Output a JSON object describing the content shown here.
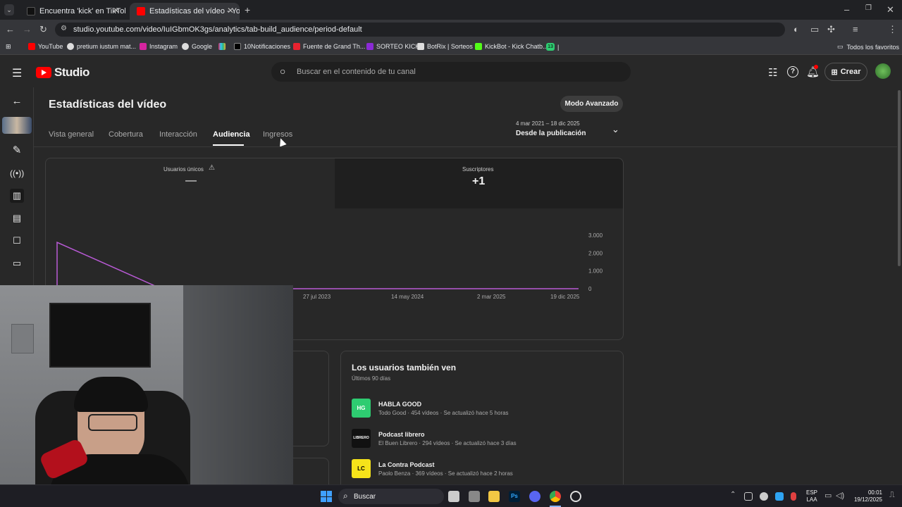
{
  "browser": {
    "tabs": [
      {
        "title": "Encuentra 'kick' en TikTok | Bus",
        "active": false
      },
      {
        "title": "Estadísticas del vídeo - YouTube",
        "active": true
      }
    ],
    "url": "studio.youtube.com/video/IuIGbmOK3gs/analytics/tab-build_audience/period-default",
    "bookmarks": [
      "YouTube",
      "pretium iustum mat...",
      "Instagram",
      "Google",
      "10Notificaciones",
      "Fuente de Grand Th...",
      "SORTEO KICK",
      "BotRix | Sorteos",
      "KickBot - Kick Chatb...",
      "13",
      "|"
    ],
    "all_favorites": "Todos los favoritos"
  },
  "studio": {
    "logo": "Studio",
    "search_placeholder": "Buscar en el contenido de tu canal",
    "create_label": "Crear",
    "page_title": "Estadísticas del vídeo",
    "advanced_mode": "Modo Avanzado",
    "tabs": [
      "Vista general",
      "Cobertura",
      "Interacción",
      "Audiencia",
      "Ingresos"
    ],
    "active_tab": "Audiencia",
    "date_range": "4 mar 2021 – 18 dic 2025",
    "date_label": "Desde la publicación",
    "metrics": [
      {
        "label": "Usuarios únicos",
        "value": "—"
      },
      {
        "label": "Suscriptores",
        "value": "+1"
      }
    ],
    "panel_title": "Los usuarios también ven",
    "panel_subtitle": "Últimos 90 días",
    "channels": [
      {
        "name": "HABLA GOOD",
        "meta": "Todo Good · 454 vídeos · Se actualizó hace 5 horas",
        "color": "#2ecc71",
        "badge": "HG"
      },
      {
        "name": "Podcast librero",
        "meta": "El Buen Librero · 294 vídeos · Se actualizó hace 3 días",
        "color": "#111111",
        "badge": "LIBRERO"
      },
      {
        "name": "La Contra Podcast",
        "meta": "Paolo Benza · 369 vídeos · Se actualizó hace 2 horas",
        "color": "#f5e31a",
        "badge": "LC"
      }
    ]
  },
  "chart_data": {
    "type": "line",
    "x_ticks": [
      "27 jul 2023",
      "14 may 2024",
      "2 mar 2025",
      "19 dic 2025"
    ],
    "y_ticks": [
      "3.000",
      "2.000",
      "1.000",
      "0"
    ],
    "ylim": [
      0,
      3000
    ],
    "series": [
      {
        "values": [
          2600,
          0,
          0,
          0,
          0,
          0
        ]
      }
    ],
    "color": "#b95ad6"
  },
  "taskbar": {
    "search": "Buscar",
    "lang": "ESP",
    "layout": "LAA",
    "time": "00:01",
    "date": "19/12/2025"
  }
}
